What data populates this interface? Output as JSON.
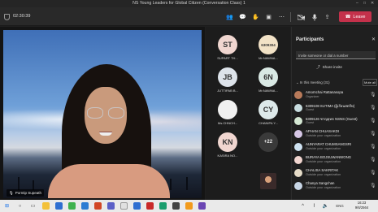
{
  "window": {
    "title": "NS Young Leaders for Global Citizen (Conversation Class) 1"
  },
  "toolbar": {
    "timer": "02:30:39",
    "leave_label": "Leave"
  },
  "stage": {
    "presenter_name": "Porntip Supeath"
  },
  "grid": {
    "tiles": [
      {
        "initials": "ST",
        "name": "SUPART TH...",
        "color": "#f0d6d0"
      },
      {
        "initials": "6309304",
        "name": "Mr.NAWNA...",
        "color": "#f2e2c6"
      },
      {
        "initials": "JB",
        "name": "JUTTIPAB B...",
        "color": "#dde3ea"
      },
      {
        "initials": "6N",
        "name": "Mr.NAWNA...",
        "color": "#d9e9e4"
      },
      {
        "initials": "",
        "name": "Ms.CHNCH...",
        "color": "#f1f1f1"
      },
      {
        "initials": "CY",
        "name": "CHANIPA Y...",
        "color": "#dde9ea"
      },
      {
        "initials": "KN",
        "name": "KASIRA NO...",
        "color": "#f0d6d0"
      },
      {
        "initials": "+22",
        "name": "",
        "color": "#3a3a3a"
      }
    ]
  },
  "panel": {
    "title": "Participants",
    "invite_placeholder": "Invite someone or dial a number",
    "share_invite": "Share invite",
    "in_meeting": "In this meeting (31)",
    "mute_all": "Mute all",
    "participants": [
      {
        "name": "Amornchai Rattanasopa",
        "role": "Organizer",
        "color": "#b87a5a"
      },
      {
        "name": "6309108 SUTIMA (ผู้เรียนสตรีท)",
        "role": "Guest",
        "color": "#c8dde0"
      },
      {
        "name": "6309126 ชาญยุทธ NSNS (Guest)",
        "role": "Guest",
        "color": "#d5e8d4"
      },
      {
        "name": "APHAN CHUASAKDI",
        "role": "Outside your organization",
        "color": "#d6c7e6"
      },
      {
        "name": "AUNYARAT CHUMSANGSRI",
        "role": "Outside your organization",
        "color": "#cfe3f2"
      },
      {
        "name": "BURAYA BOJSUWANWONG",
        "role": "Outside your organization",
        "color": "#f2d6d0"
      },
      {
        "name": "CHALISA SAKRITAK",
        "role": "Outside your organization",
        "color": "#e6dcc8"
      },
      {
        "name": "Chanya Sangchan",
        "role": "Outside your organization",
        "color": "#c8d6e6"
      }
    ]
  },
  "taskbar": {
    "time": "16:23",
    "date": "9/6/2564",
    "lang": "ENG"
  }
}
